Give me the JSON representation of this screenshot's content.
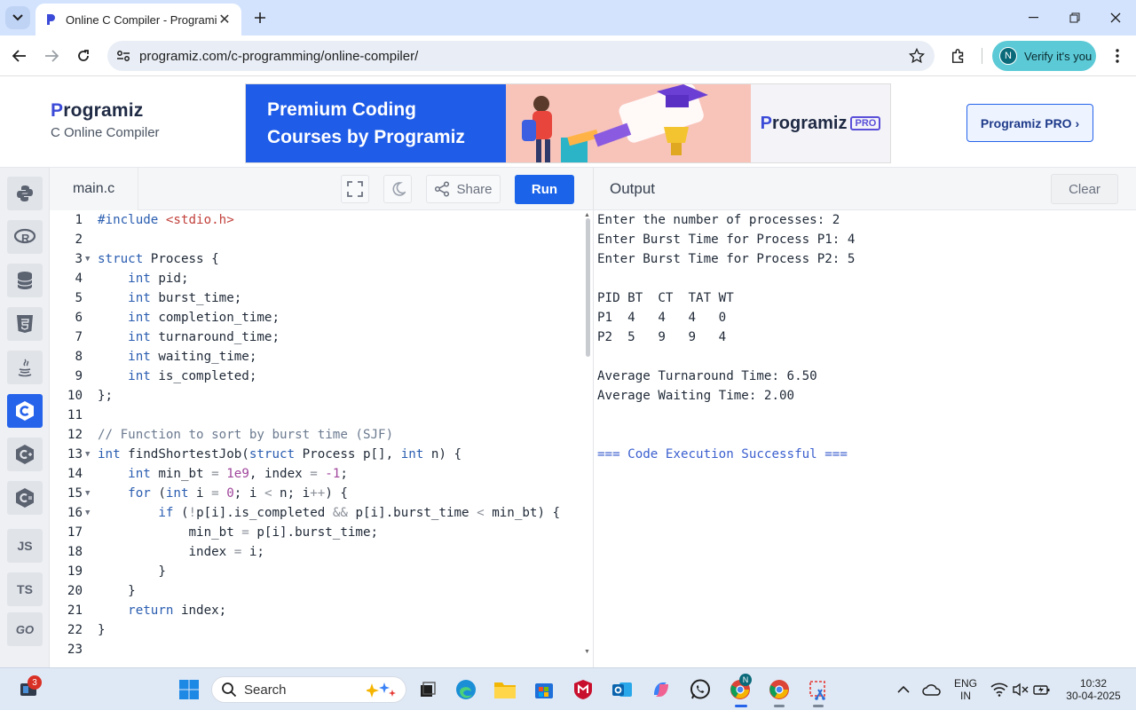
{
  "browser": {
    "tab_title": "Online C Compiler - Programiz",
    "url": "programiz.com/c-programming/online-compiler/",
    "profile_initial": "N",
    "profile_label": "Verify it's you"
  },
  "header": {
    "brand_name": "rogramiz",
    "brand_initial": "P",
    "brand_subtitle": "C Online Compiler",
    "banner_line1": "Premium Coding",
    "banner_line2": "Courses by Programiz",
    "banner_brand_initial": "P",
    "banner_brand": "rogramiz",
    "banner_badge": "PRO",
    "pro_button": "Programiz PRO ›"
  },
  "rail": {
    "js_label": "JS",
    "ts_label": "TS",
    "go_label": "GO"
  },
  "editor": {
    "file_name": "main.c",
    "share_label": "Share",
    "run_label": "Run",
    "line_numbers": [
      "1",
      "2",
      "3",
      "4",
      "5",
      "6",
      "7",
      "8",
      "9",
      "10",
      "11",
      "12",
      "13",
      "14",
      "15",
      "16",
      "17",
      "18",
      "19",
      "20",
      "21",
      "22",
      "23"
    ]
  },
  "output": {
    "title": "Output",
    "clear_label": "Clear",
    "lines": [
      "Enter the number of processes: 2",
      "Enter Burst Time for Process P1: 4",
      "Enter Burst Time for Process P2: 5",
      "",
      "PID BT  CT  TAT WT",
      "P1  4   4   4   0",
      "P2  5   9   9   4",
      "",
      "Average Turnaround Time: 6.50",
      "Average Waiting Time: 2.00",
      "",
      "",
      "=== Code Execution Successful ==="
    ]
  },
  "taskbar": {
    "search_placeholder": "Search",
    "notification_count": "3",
    "chrome_profile_initial": "N",
    "lang_line1": "ENG",
    "lang_line2": "IN",
    "time": "10:32",
    "date": "30-04-2025"
  },
  "colors": {
    "accent": "#1b64ea",
    "chrome_tabbar": "#d3e3fd",
    "profile_chip": "#5bcad6"
  }
}
